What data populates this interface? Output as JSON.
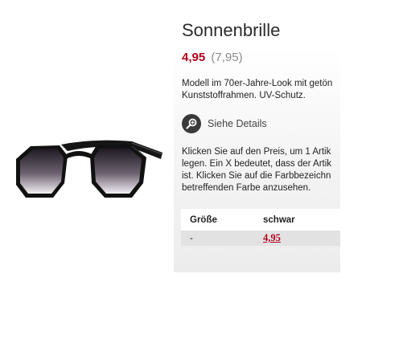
{
  "product": {
    "title": "Sonnenbrille",
    "price_current": "4,95",
    "price_old": "(7,95)",
    "description_lines": [
      "Modell im 70er-Jahre-Look mit getön",
      "Kunststoffrahmen. UV-Schutz."
    ],
    "details_label": "Siehe Details",
    "details_icon": "magnifier-plus-icon",
    "image_icon": "sunglasses-image"
  },
  "help_lines": [
    "Klicken Sie auf den Preis, um 1 Artik",
    "legen. Ein X bedeutet, dass der Artik",
    "ist. Klicken Sie auf die Farbbezeichn",
    "betreffenden Farbe anzusehen."
  ],
  "size_table": {
    "header_size": "Größe",
    "header_color": "schwar",
    "rows": [
      {
        "size": "-",
        "price": "4,95"
      }
    ]
  },
  "colors": {
    "price_red": "#b3001b",
    "icon_dark": "#3a3a3a",
    "row_grey": "#e2e2e2"
  }
}
